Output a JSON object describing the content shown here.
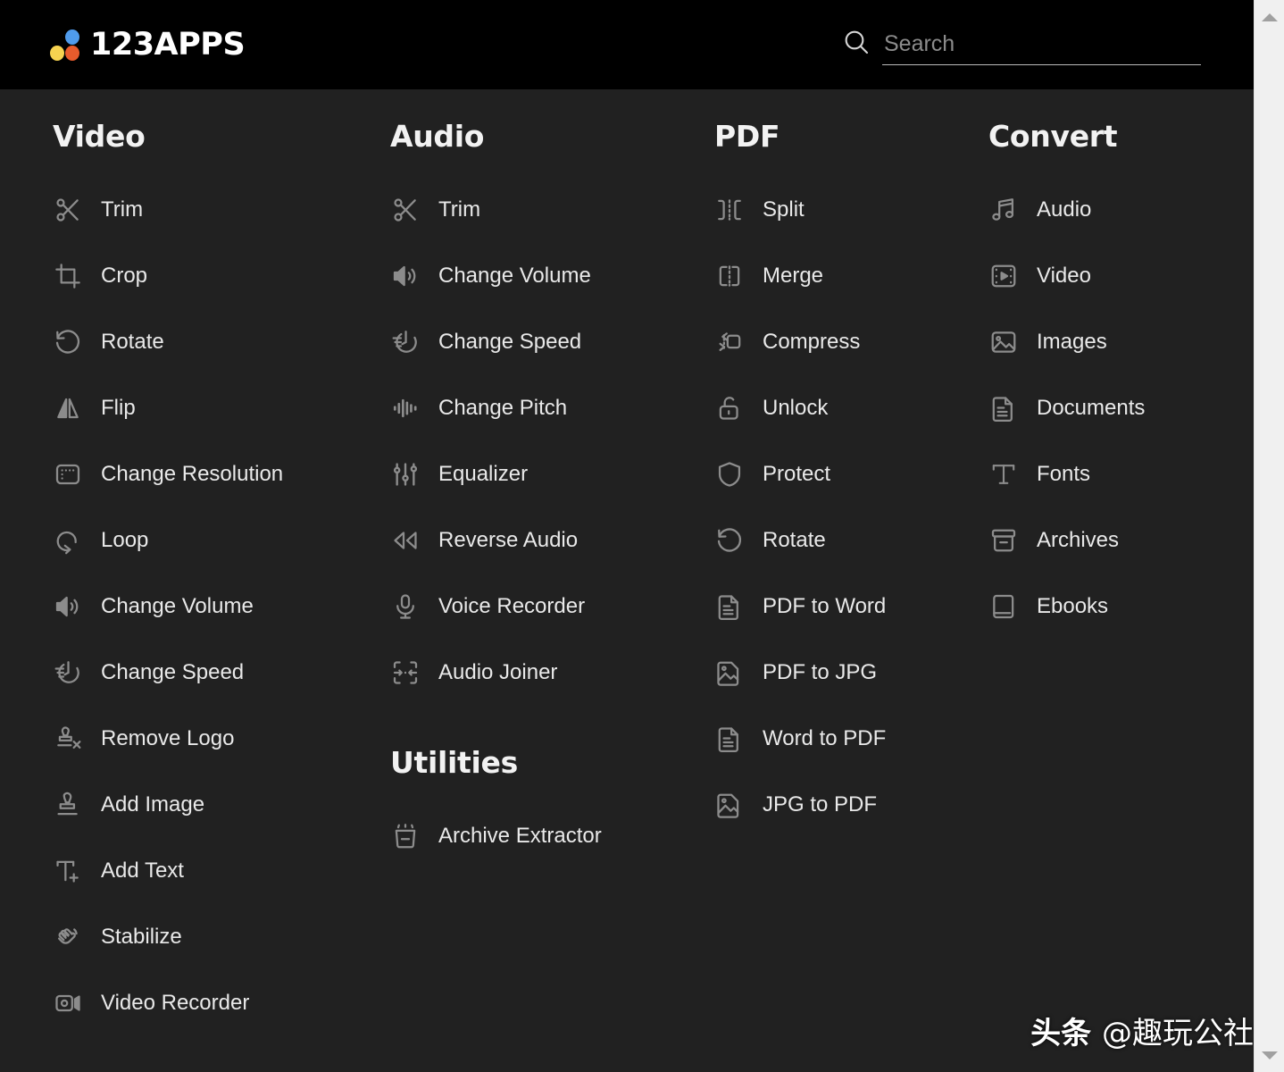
{
  "header": {
    "logo_text": "123APPS",
    "logo_dots": [
      {
        "name": "blue",
        "color": "#4f9bec"
      },
      {
        "name": "yellow",
        "color": "#f6d250"
      },
      {
        "name": "orange",
        "color": "#e85b2c"
      }
    ],
    "search": {
      "placeholder": "Search",
      "value": "",
      "icon": "search-icon"
    }
  },
  "columns": [
    {
      "id": "video",
      "title": "Video",
      "items": [
        {
          "label": "Trim",
          "icon": "scissors-icon"
        },
        {
          "label": "Crop",
          "icon": "crop-icon"
        },
        {
          "label": "Rotate",
          "icon": "rotate-ccw-icon"
        },
        {
          "label": "Flip",
          "icon": "flip-icon"
        },
        {
          "label": "Change Resolution",
          "icon": "resolution-icon"
        },
        {
          "label": "Loop",
          "icon": "loop-icon"
        },
        {
          "label": "Change Volume",
          "icon": "speaker-icon"
        },
        {
          "label": "Change Speed",
          "icon": "speed-icon"
        },
        {
          "label": "Remove Logo",
          "icon": "stamp-x-icon"
        },
        {
          "label": "Add Image",
          "icon": "stamp-icon"
        },
        {
          "label": "Add Text",
          "icon": "text-plus-icon"
        },
        {
          "label": "Stabilize",
          "icon": "hand-icon"
        },
        {
          "label": "Video Recorder",
          "icon": "camcorder-icon"
        }
      ]
    },
    {
      "id": "audio",
      "title": "Audio",
      "items": [
        {
          "label": "Trim",
          "icon": "scissors-icon"
        },
        {
          "label": "Change Volume",
          "icon": "speaker-icon"
        },
        {
          "label": "Change Speed",
          "icon": "speed-icon"
        },
        {
          "label": "Change Pitch",
          "icon": "waveform-icon"
        },
        {
          "label": "Equalizer",
          "icon": "equalizer-icon"
        },
        {
          "label": "Reverse Audio",
          "icon": "rewind-icon"
        },
        {
          "label": "Voice Recorder",
          "icon": "microphone-icon"
        },
        {
          "label": "Audio Joiner",
          "icon": "join-icon"
        }
      ],
      "subsection": {
        "title": "Utilities",
        "items": [
          {
            "label": "Archive Extractor",
            "icon": "archive-extract-icon"
          }
        ]
      }
    },
    {
      "id": "pdf",
      "title": "PDF",
      "items": [
        {
          "label": "Split",
          "icon": "split-icon"
        },
        {
          "label": "Merge",
          "icon": "merge-icon"
        },
        {
          "label": "Compress",
          "icon": "compress-icon"
        },
        {
          "label": "Unlock",
          "icon": "unlock-icon"
        },
        {
          "label": "Protect",
          "icon": "shield-icon"
        },
        {
          "label": "Rotate",
          "icon": "rotate-ccw-icon"
        },
        {
          "label": "PDF to Word",
          "icon": "document-icon"
        },
        {
          "label": "PDF to JPG",
          "icon": "image-icon"
        },
        {
          "label": "Word to PDF",
          "icon": "document-icon"
        },
        {
          "label": "JPG to PDF",
          "icon": "image-icon"
        }
      ]
    },
    {
      "id": "convert",
      "title": "Convert",
      "items": [
        {
          "label": "Audio",
          "icon": "music-note-icon"
        },
        {
          "label": "Video",
          "icon": "film-icon"
        },
        {
          "label": "Images",
          "icon": "image-icon"
        },
        {
          "label": "Documents",
          "icon": "document-icon"
        },
        {
          "label": "Fonts",
          "icon": "font-t-icon"
        },
        {
          "label": "Archives",
          "icon": "archive-icon"
        },
        {
          "label": "Ebooks",
          "icon": "book-icon"
        }
      ]
    }
  ],
  "watermark": {
    "prefix": "头条",
    "handle": "@趣玩公社"
  },
  "scrollbar": {
    "up_arrow": "scroll-up-arrow",
    "down_arrow": "scroll-down-arrow"
  },
  "colors": {
    "header_bg": "#000000",
    "body_bg": "#212121",
    "text": "#e9e9e9",
    "icon": "#8c8c8c",
    "title": "#f2f2f2",
    "scrollbar_track": "#f0f0f0"
  }
}
